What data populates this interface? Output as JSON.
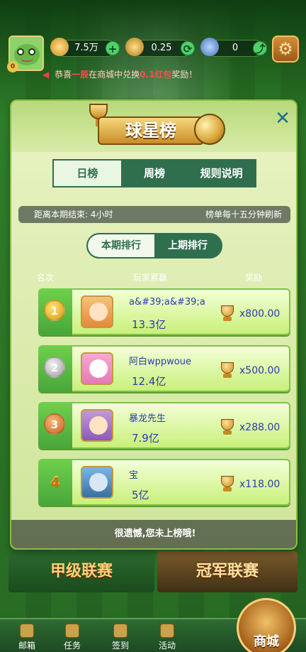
{
  "topbar": {
    "vip_label": "0",
    "gold": "7.5万",
    "coupon": "0.25",
    "medal": "0",
    "notice_prefix": "恭喜",
    "notice_name": "一辰",
    "notice_mid": "在商城中兑换",
    "notice_item": "0.1红包",
    "notice_suffix": "奖励！"
  },
  "modal": {
    "title": "球星榜",
    "tabs": [
      "日榜",
      "周榜",
      "规则说明"
    ],
    "info_left": "距离本期结束: 4小时",
    "info_right": "榜单每十五分钟刷新",
    "subtabs": [
      "本期排行",
      "上期排行"
    ],
    "columns": [
      "名次",
      "玩家累赢",
      "奖励"
    ],
    "rows": [
      {
        "rank": "1",
        "name": "a&#39;a&#39;a",
        "score": "13.3亿",
        "reward": "x800.00"
      },
      {
        "rank": "2",
        "name": "阿白wppwoue",
        "score": "12.4亿",
        "reward": "x500.00"
      },
      {
        "rank": "3",
        "name": "暴龙先生",
        "score": "7.9亿",
        "reward": "x288.00"
      },
      {
        "rank": "4",
        "name": "宝",
        "score": "5亿",
        "reward": "x118.00"
      }
    ],
    "footer": "很遗憾,您未上榜哦!"
  },
  "banners": {
    "left": "甲级联赛",
    "right": "冠军联赛"
  },
  "bottom_nav": [
    "邮箱",
    "任务",
    "签到",
    "活动"
  ],
  "shop": "商城",
  "colors": {
    "accent_green": "#2f6f4e",
    "text_blue": "#2b3ca8",
    "row_green": "#c9f07a"
  }
}
